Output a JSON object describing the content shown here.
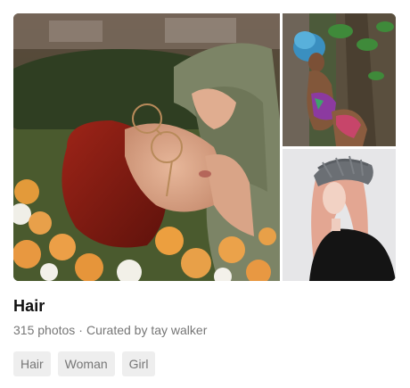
{
  "collection": {
    "title": "Hair",
    "photo_count": "315 photos",
    "separator": "·",
    "curated_by": "Curated by tay walker",
    "photos": [
      {
        "name": "main-photo",
        "depicts": "woman with red hair and glasses lying among orange flowers"
      },
      {
        "name": "top-right-photo",
        "depicts": "woman with blue hair leaning against a tree"
      },
      {
        "name": "bottom-right-photo",
        "depicts": "woman with pink hair wearing a grey knit cap"
      }
    ]
  },
  "tags": [
    {
      "label": "Hair"
    },
    {
      "label": "Woman"
    },
    {
      "label": "Girl"
    }
  ],
  "colors": {
    "title": "#111111",
    "meta": "#767676",
    "tag_bg": "#eeeeee"
  }
}
